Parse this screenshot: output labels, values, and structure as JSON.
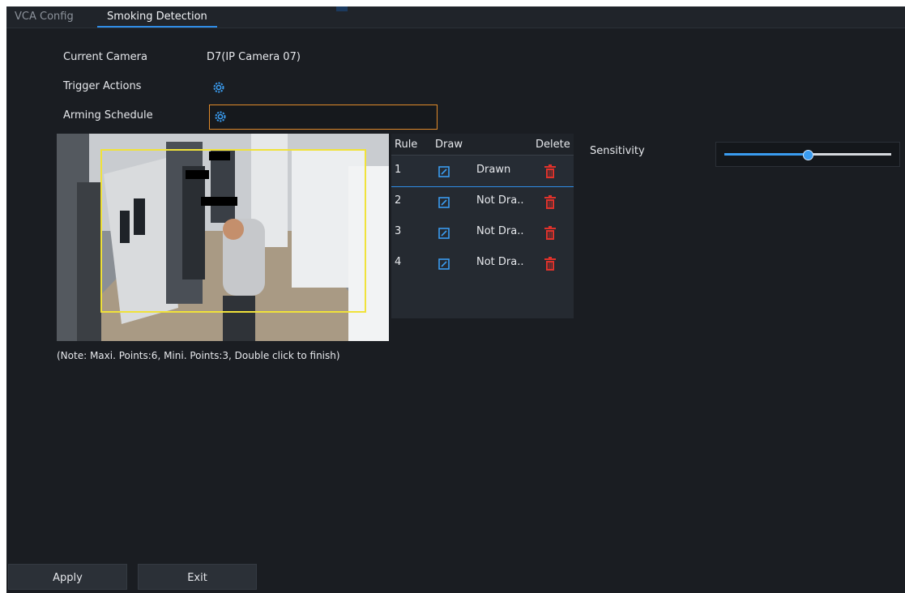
{
  "tabs": [
    {
      "label": "VCA Config",
      "active": false
    },
    {
      "label": "Smoking Detection",
      "active": true
    }
  ],
  "form": {
    "current_camera_label": "Current Camera",
    "current_camera_value": "D7(IP Camera 07)",
    "trigger_actions_label": "Trigger Actions",
    "arming_schedule_label": "Arming Schedule"
  },
  "rules_table": {
    "headers": {
      "rule": "Rule",
      "draw": "Draw",
      "delete": "Delete"
    },
    "rows": [
      {
        "rule": "1",
        "status": "Drawn"
      },
      {
        "rule": "2",
        "status": "Not Dra.."
      },
      {
        "rule": "3",
        "status": "Not Dra.."
      },
      {
        "rule": "4",
        "status": "Not Dra.."
      }
    ]
  },
  "sensitivity": {
    "label": "Sensitivity",
    "level": 0.5
  },
  "note": "(Note: Maxi. Points:6, Mini. Points:3, Double click to finish)",
  "buttons": {
    "apply": "Apply",
    "exit": "Exit"
  },
  "colors": {
    "accent": "#2f8ee8",
    "schedule_border": "#e08a2a",
    "delete_icon": "#e0322b",
    "detection_area": "#f0e23a"
  },
  "icons": {
    "trigger_actions": "gear-icon",
    "arming_schedule": "gear-icon",
    "draw": "edit-icon",
    "delete": "trash-icon"
  }
}
